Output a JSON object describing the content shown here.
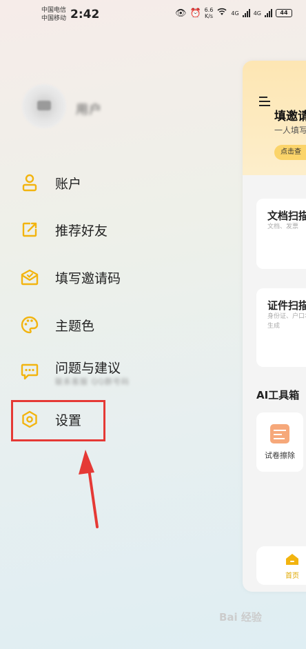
{
  "status_bar": {
    "carrier1": "中国电信",
    "carrier2": "中国移动",
    "time": "2:42",
    "speed_value": "6.6",
    "speed_unit": "K/s",
    "net1": "4G",
    "net2": "4G",
    "battery": "44"
  },
  "drawer": {
    "username": "用户",
    "menu": [
      {
        "label": "账户",
        "icon": "user-icon"
      },
      {
        "label": "推荐好友",
        "icon": "share-icon"
      },
      {
        "label": "填写邀请码",
        "icon": "envelope-icon"
      },
      {
        "label": "主题色",
        "icon": "palette-icon"
      },
      {
        "label": "问题与建议",
        "icon": "chat-icon"
      },
      {
        "label": "设置",
        "icon": "gear-icon"
      }
    ],
    "feedback_sub": "联系客服 QQ群号码",
    "accent_color": "#f2b40f",
    "highlight_color": "#e53935"
  },
  "main": {
    "banner_title": "填邀请",
    "banner_sub": "一人填写",
    "banner_button": "点击查",
    "tools": [
      {
        "title": "文档扫描",
        "desc": "文档、发票"
      },
      {
        "title": "证件扫描",
        "desc": "身份证、户口本生成"
      }
    ],
    "ai_section": "AI工具箱",
    "ai_tools": [
      {
        "label": "试卷擦除"
      }
    ],
    "nav_home": "首页"
  },
  "watermark": "Bai 经验"
}
